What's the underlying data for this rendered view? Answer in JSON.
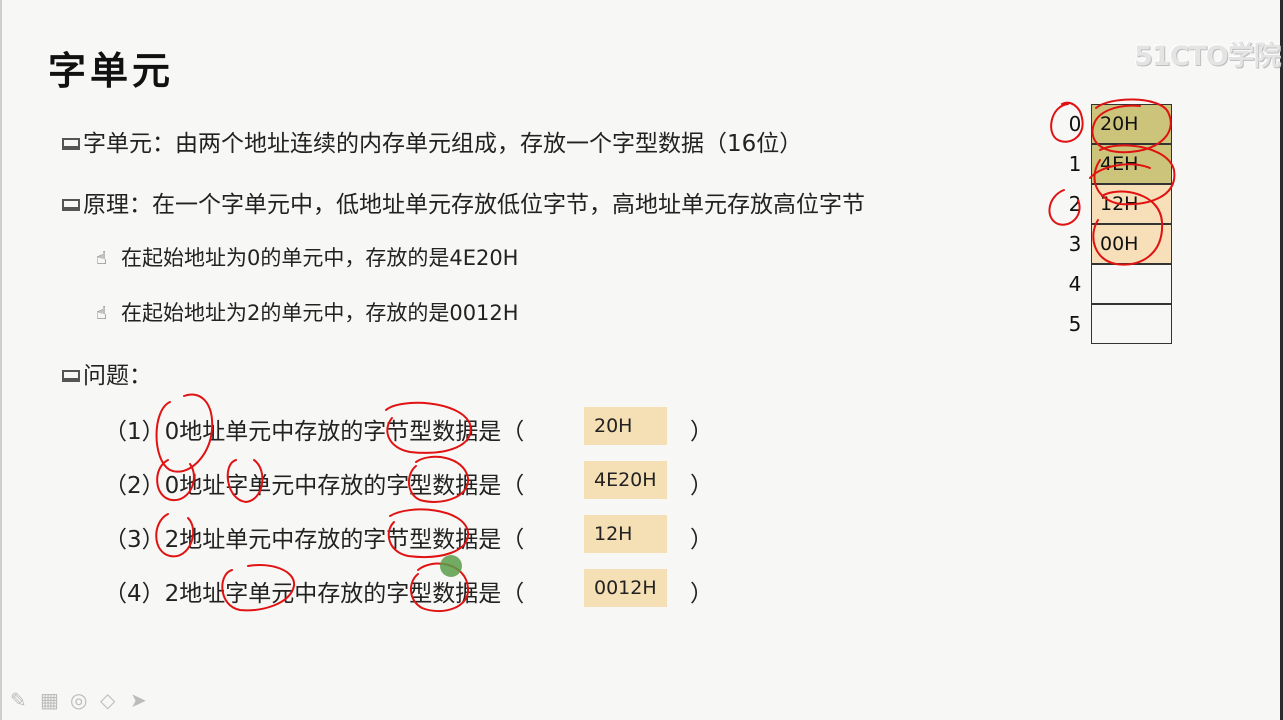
{
  "slide": {
    "title": "字单元",
    "watermark": "51CTO学院",
    "definition": "字单元：由两个地址连续的内存单元组成，存放一个字型数据（16位）",
    "principle": "原理：在一个字单元中，低地址单元存放低位字节，高地址单元存放高位字节",
    "examples": [
      "在起始地址为0的单元中，存放的是4E20H",
      "在起始地址为2的单元中，存放的是0012H"
    ],
    "question_heading": "问题：",
    "questions": [
      {
        "text": "（1）0地址单元中存放的字节型数据是（",
        "answer": "20H",
        "close": "）"
      },
      {
        "text": "（2）0地址字单元中存放的字型数据是（",
        "answer": "4E20H",
        "close": "）"
      },
      {
        "text": "（3）2地址单元中存放的字节型数据是（",
        "answer": "12H",
        "close": "）"
      },
      {
        "text": "（4）2地址字单元中存放的字型数据是（",
        "answer": "0012H",
        "close": "）"
      }
    ]
  },
  "memory": {
    "cells": [
      {
        "address": "0",
        "value": "20H",
        "fill": "#ccc47a"
      },
      {
        "address": "1",
        "value": "4EH",
        "fill": "#ccc47a"
      },
      {
        "address": "2",
        "value": "12H",
        "fill": "#f6dfb9"
      },
      {
        "address": "3",
        "value": "00H",
        "fill": "#f6dfb9"
      },
      {
        "address": "4",
        "value": "",
        "fill": "#f7f7f5"
      },
      {
        "address": "5",
        "value": "",
        "fill": "#f7f7f5"
      }
    ]
  },
  "colors": {
    "ink": "#e01212",
    "answer_fill": "#f5dfb5",
    "pointer": "#5a9e4a"
  },
  "toolbar": {
    "icons": [
      "pen-icon",
      "keyboard-icon",
      "highlighter-icon",
      "eraser-icon",
      "pointer-icon"
    ]
  }
}
